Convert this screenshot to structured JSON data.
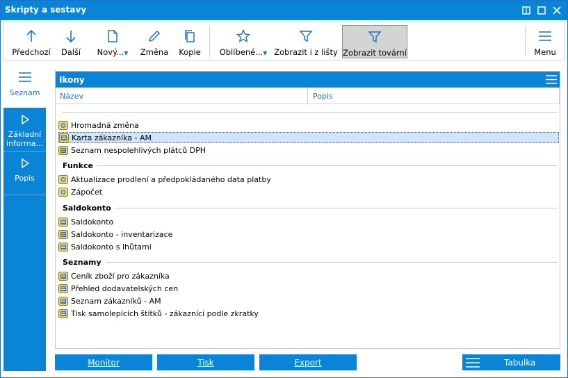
{
  "window": {
    "title": "Skripty a sestavy"
  },
  "toolbar": {
    "prev": "Předchozí",
    "next": "Další",
    "new": "Nový...",
    "change": "Změna",
    "copy": "Kopie",
    "favorites": "Oblíbené...",
    "show_from_bar": "Zobrazit i z lišty",
    "show_factory": "Zobrazit tovární",
    "menu": "Menu"
  },
  "sidenav": {
    "items": [
      {
        "label": "Seznam"
      },
      {
        "label": "Základní informa..."
      },
      {
        "label": "Popis"
      }
    ]
  },
  "panel": {
    "title": "Ikony",
    "columns": [
      "Název",
      "Popis"
    ]
  },
  "list": {
    "ungrouped": [
      "Hromadná změna",
      "Karta zákazníka - AM",
      "Seznam nespolehlivých plátců DPH"
    ],
    "groups": [
      {
        "name": "Funkce",
        "items": [
          "Aktualizace prodlení a předpokládaného data platby",
          "Zápočet"
        ]
      },
      {
        "name": "Saldokonto",
        "items": [
          "Saldokonto",
          "Saldokonto - inventarizace",
          "Saldokonto s lhůtami"
        ]
      },
      {
        "name": "Seznamy",
        "items": [
          "Ceník zboží pro zákazníka",
          "Přehled dodavatelských cen",
          "Seznam zákazníků - AM",
          "Tisk samolepících štítků - zákazníci podle zkratky"
        ]
      }
    ]
  },
  "bottom": {
    "monitor": "Monitor",
    "print": "Tisk",
    "export": "Export",
    "table": "Tabulka"
  },
  "colors": {
    "accent": "#0a84d6",
    "selection": "#cfe6fa"
  }
}
